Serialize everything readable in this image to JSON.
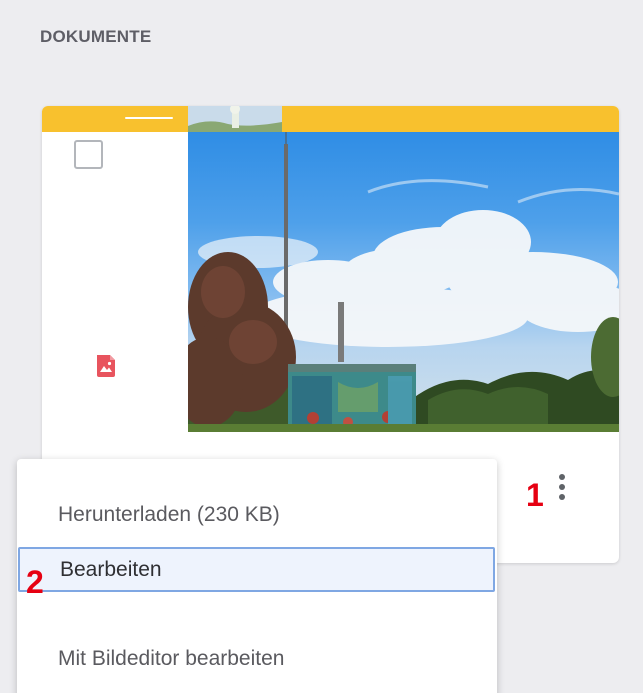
{
  "section": {
    "title": "DOKUMENTE"
  },
  "document_card": {
    "file_type_icon": "image-file-icon",
    "colors": {
      "top_strip": "#f8c12e",
      "file_icon": "#e8545e"
    }
  },
  "context_menu": {
    "items": [
      {
        "label": "Herunterladen (230 KB)"
      },
      {
        "label": "Bearbeiten",
        "highlighted": true
      },
      {
        "label": "Mit Bildeditor bearbeiten"
      }
    ],
    "highlight_border_color": "#7fa7e3"
  },
  "annotations": {
    "marker_1": "1",
    "marker_2": "2"
  }
}
